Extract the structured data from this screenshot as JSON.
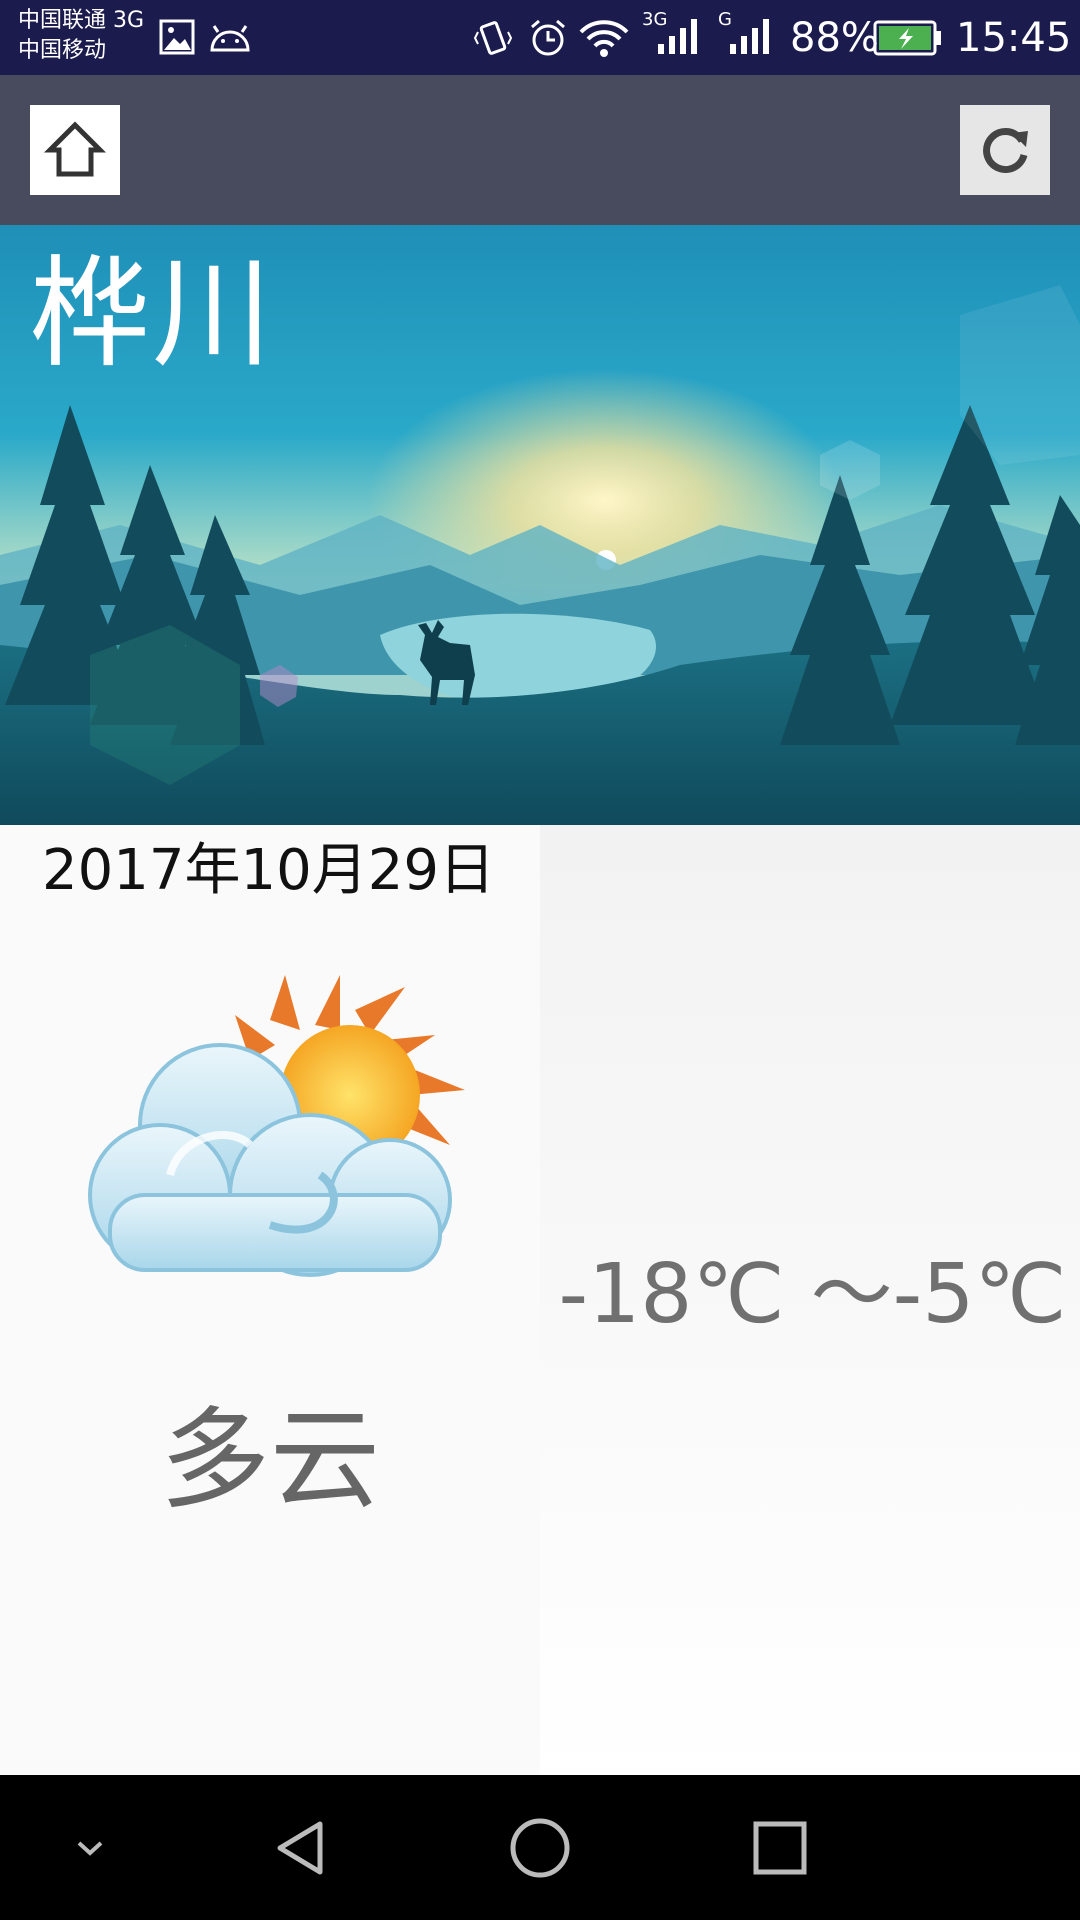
{
  "status_bar": {
    "carrier_1": "中国联通 3G",
    "carrier_2": "中国移动",
    "net_1": "3G",
    "net_2": "G",
    "battery": "88%",
    "time": "15:45",
    "icons": [
      "gallery-icon",
      "android-icon",
      "vibrate-icon",
      "alarm-icon",
      "wifi-icon",
      "signal-icon",
      "signal-icon",
      "battery-icon"
    ]
  },
  "toolbar": {
    "home_icon": "home-icon",
    "refresh_icon": "refresh-icon"
  },
  "weather": {
    "city": "桦川",
    "date": "2017年10月29日",
    "condition": "多云",
    "temperature": "-18℃ ～-5℃",
    "icon": "partly-cloudy-icon"
  },
  "nav_bar": {
    "icons": [
      "chevron-down-icon",
      "back-icon",
      "home-circle-icon",
      "recents-icon"
    ]
  },
  "colors": {
    "status_bar": "#1c1b4e",
    "app_bar": "#484b5d",
    "hero_sky_top": "#1f8fb8",
    "hero_sky_glow": "#f5e39c",
    "text_gray": "#707070",
    "battery_fill": "#4caf50"
  }
}
